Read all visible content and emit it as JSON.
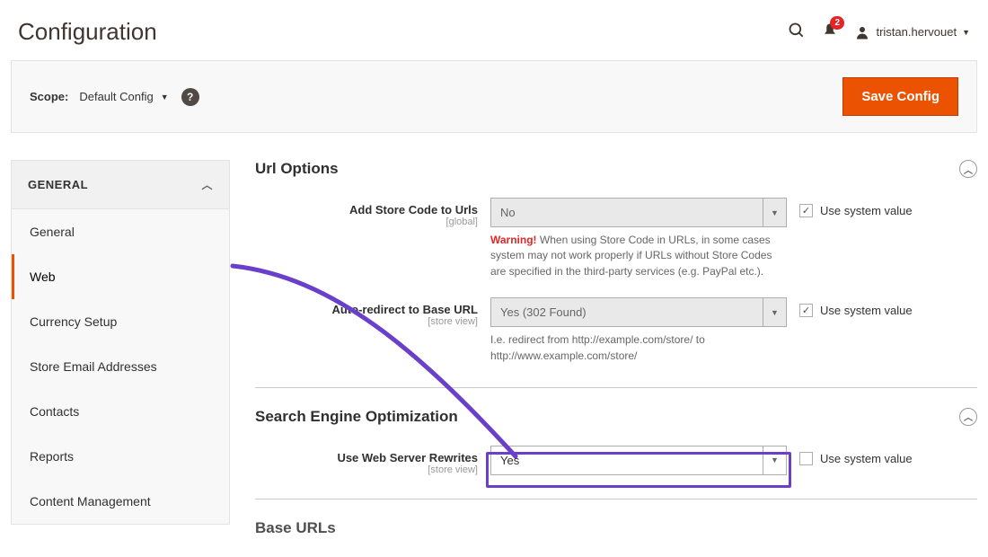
{
  "header": {
    "title": "Configuration",
    "notification_count": "2",
    "user_name": "tristan.hervouet"
  },
  "toolbar": {
    "scope_label": "Scope:",
    "scope_value": "Default Config",
    "save_label": "Save Config"
  },
  "sidebar": {
    "group": "GENERAL",
    "items": [
      "General",
      "Web",
      "Currency Setup",
      "Store Email Addresses",
      "Contacts",
      "Reports",
      "Content Management"
    ],
    "active_index": 1
  },
  "sections": {
    "url_options": {
      "title": "Url Options",
      "fields": {
        "add_store_code": {
          "label": "Add Store Code to Urls",
          "scope": "[global]",
          "value": "No",
          "use_system_label": "Use system value",
          "use_system_checked": true,
          "note_warn": "Warning!",
          "note": "When using Store Code in URLs, in some cases system may not work properly if URLs without Store Codes are specified in the third-party services (e.g. PayPal etc.)."
        },
        "auto_redirect": {
          "label": "Auto-redirect to Base URL",
          "scope": "[store view]",
          "value": "Yes (302 Found)",
          "use_system_label": "Use system value",
          "use_system_checked": true,
          "note": "I.e. redirect from http://example.com/store/ to http://www.example.com/store/"
        }
      }
    },
    "seo": {
      "title": "Search Engine Optimization",
      "fields": {
        "rewrites": {
          "label": "Use Web Server Rewrites",
          "scope": "[store view]",
          "value": "Yes",
          "use_system_label": "Use system value",
          "use_system_checked": false
        }
      }
    },
    "base_urls": {
      "title": "Base URLs"
    }
  }
}
